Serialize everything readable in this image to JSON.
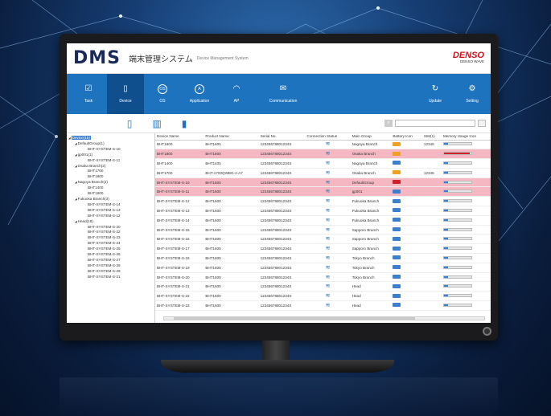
{
  "app": {
    "logo": "DMS",
    "title": "端末管理システム",
    "subtitle": "Device Management System",
    "brand": "DENSO",
    "brand_sub": "DENSO WAVE"
  },
  "tabs": [
    {
      "label": "Task",
      "icon": "task-icon"
    },
    {
      "label": "Device",
      "icon": "device-icon",
      "active": true
    },
    {
      "label": "OS",
      "icon": "os-icon"
    },
    {
      "label": "Application",
      "icon": "application-icon"
    },
    {
      "label": "AP",
      "icon": "access-point-icon"
    },
    {
      "label": "Communication",
      "icon": "communication-icon"
    }
  ],
  "right_tabs": [
    {
      "label": "Update",
      "icon": "update-icon"
    },
    {
      "label": "Setting",
      "icon": "setting-icon"
    }
  ],
  "toolbar": [
    {
      "icon": "device-add-icon"
    },
    {
      "icon": "device-move-icon"
    },
    {
      "icon": "device-remove-icon"
    }
  ],
  "tree": [
    {
      "label": "Device(15)",
      "level": 0,
      "selected": true
    },
    {
      "label": "DefaultGroup(1)",
      "level": 1
    },
    {
      "label": "BHT-SYSTEM-S-10",
      "level": 2
    },
    {
      "label": "gp001(1)",
      "level": 1
    },
    {
      "label": "BHT-SYSTEM-S-11",
      "level": 2
    },
    {
      "label": "Osaka Branch(2)",
      "level": 1
    },
    {
      "label": "BHT1700",
      "level": 2
    },
    {
      "label": "BHT1800",
      "level": 2
    },
    {
      "label": "Nagoya Branch(2)",
      "level": 1
    },
    {
      "label": "BHT1400",
      "level": 2
    },
    {
      "label": "BHT1600",
      "level": 2
    },
    {
      "label": "Fukuoka Branch(3)",
      "level": 1
    },
    {
      "label": "BHT-SYSTEM-S-14",
      "level": 2
    },
    {
      "label": "BHT-SYSTEM-S-13",
      "level": 2
    },
    {
      "label": "BHT-SYSTEM-S-12",
      "level": 2
    },
    {
      "label": "Head(18)",
      "level": 1
    },
    {
      "label": "BHT-SYSTEM-S-20",
      "level": 2
    },
    {
      "label": "BHT-SYSTEM-S-22",
      "level": 2
    },
    {
      "label": "BHT-SYSTEM-S-23",
      "level": 2
    },
    {
      "label": "BHT-SYSTEM-S-24",
      "level": 2
    },
    {
      "label": "BHT-SYSTEM-S-25",
      "level": 2
    },
    {
      "label": "BHT-SYSTEM-S-26",
      "level": 2
    },
    {
      "label": "BHT-SYSTEM-S-27",
      "level": 2
    },
    {
      "label": "BHT-SYSTEM-S-28",
      "level": 2
    },
    {
      "label": "BHT-SYSTEM-S-29",
      "level": 2
    },
    {
      "label": "BHT-SYSTEM-S-21",
      "level": 2
    }
  ],
  "table": {
    "headers": [
      "Device Name",
      "Product Name",
      "Serial No.",
      "Connection Status",
      "Main Group",
      "Battery Icon",
      "SIM(1)",
      "Memory Usage Icon"
    ],
    "rows": [
      {
        "name": "BHT1600",
        "product": "BHT1600",
        "serial": "12345678801234S",
        "group": "Nagoya Branch",
        "batt": "#f0a020",
        "sim": "12345",
        "mem": 0.15,
        "memcolor": "#3b7fd0",
        "alert": false
      },
      {
        "name": "BHT1800",
        "product": "BHT1800",
        "serial": "12345678801234S",
        "group": "Osaka Branch",
        "batt": "#f0a020",
        "sim": "",
        "mem": 0.95,
        "memcolor": "#d0202a",
        "alert": true
      },
      {
        "name": "BHT1400",
        "product": "BHT1400",
        "serial": "12345678801234S",
        "group": "Nagoya Branch",
        "batt": "#3b7fd0",
        "sim": "",
        "mem": 0.15,
        "memcolor": "#3b7fd0",
        "alert": false
      },
      {
        "name": "BHT1700",
        "product": "BHT-1700QWBG-2-A7",
        "serial": "12345678801234S",
        "group": "Osaka Branch",
        "batt": "#f0a020",
        "sim": "12345",
        "mem": 0.15,
        "memcolor": "#3b7fd0",
        "alert": false
      },
      {
        "name": "BHT-SYSTEM-S-10",
        "product": "BHT1600",
        "serial": "12345678801234S",
        "group": "DefaultGroup",
        "batt": "#d0202a",
        "sim": "",
        "mem": 0.15,
        "memcolor": "#3b7fd0",
        "alert": true
      },
      {
        "name": "BHT-SYSTEM-S-11",
        "product": "BHT1600",
        "serial": "12345678801234S",
        "group": "gp001",
        "batt": "#3b7fd0",
        "sim": "",
        "mem": 0.15,
        "memcolor": "#3b7fd0",
        "alert": true
      },
      {
        "name": "BHT-SYSTEM-S-12",
        "product": "BHT1600",
        "serial": "12345678801234S",
        "group": "Fukuoka Branch",
        "batt": "#3b7fd0",
        "sim": "",
        "mem": 0.15,
        "memcolor": "#3b7fd0",
        "alert": false
      },
      {
        "name": "BHT-SYSTEM-S-13",
        "product": "BHT1600",
        "serial": "12345678801234S",
        "group": "Fukuoka Branch",
        "batt": "#3b7fd0",
        "sim": "",
        "mem": 0.15,
        "memcolor": "#3b7fd0",
        "alert": false
      },
      {
        "name": "BHT-SYSTEM-S-14",
        "product": "BHT1600",
        "serial": "12345678801234S",
        "group": "Fukuoka Branch",
        "batt": "#3b7fd0",
        "sim": "",
        "mem": 0.15,
        "memcolor": "#3b7fd0",
        "alert": false
      },
      {
        "name": "BHT-SYSTEM-S-15",
        "product": "BHT1600",
        "serial": "12345678801234S",
        "group": "Sapporo Branch",
        "batt": "#3b7fd0",
        "sim": "",
        "mem": 0.15,
        "memcolor": "#3b7fd0",
        "alert": false
      },
      {
        "name": "BHT-SYSTEM-S-16",
        "product": "BHT1600",
        "serial": "12345678801234S",
        "group": "Sapporo Branch",
        "batt": "#3b7fd0",
        "sim": "",
        "mem": 0.15,
        "memcolor": "#3b7fd0",
        "alert": false
      },
      {
        "name": "BHT-SYSTEM-S-17",
        "product": "BHT1600",
        "serial": "12345678801234S",
        "group": "Sapporo Branch",
        "batt": "#3b7fd0",
        "sim": "",
        "mem": 0.15,
        "memcolor": "#3b7fd0",
        "alert": false
      },
      {
        "name": "BHT-SYSTEM-S-18",
        "product": "BHT1600",
        "serial": "12345678801234S",
        "group": "Tokyo Branch",
        "batt": "#3b7fd0",
        "sim": "",
        "mem": 0.15,
        "memcolor": "#3b7fd0",
        "alert": false
      },
      {
        "name": "BHT-SYSTEM-S-19",
        "product": "BHT1600",
        "serial": "12345678801234S",
        "group": "Tokyo Branch",
        "batt": "#3b7fd0",
        "sim": "",
        "mem": 0.15,
        "memcolor": "#3b7fd0",
        "alert": false
      },
      {
        "name": "BHT-SYSTEM-S-20",
        "product": "BHT1600",
        "serial": "12345678801234S",
        "group": "Tokyo Branch",
        "batt": "#3b7fd0",
        "sim": "",
        "mem": 0.15,
        "memcolor": "#3b7fd0",
        "alert": false
      },
      {
        "name": "BHT-SYSTEM-S-21",
        "product": "BHT1600",
        "serial": "12345678801234S",
        "group": "Head",
        "batt": "#3b7fd0",
        "sim": "",
        "mem": 0.15,
        "memcolor": "#3b7fd0",
        "alert": false
      },
      {
        "name": "BHT-SYSTEM-S-22",
        "product": "BHT1600",
        "serial": "12345678801234S",
        "group": "Head",
        "batt": "#3b7fd0",
        "sim": "",
        "mem": 0.15,
        "memcolor": "#3b7fd0",
        "alert": false
      },
      {
        "name": "BHT-SYSTEM-S-23",
        "product": "BHT1600",
        "serial": "12345678801234S",
        "group": "Head",
        "batt": "#3b7fd0",
        "sim": "",
        "mem": 0.15,
        "memcolor": "#3b7fd0",
        "alert": false
      }
    ]
  }
}
